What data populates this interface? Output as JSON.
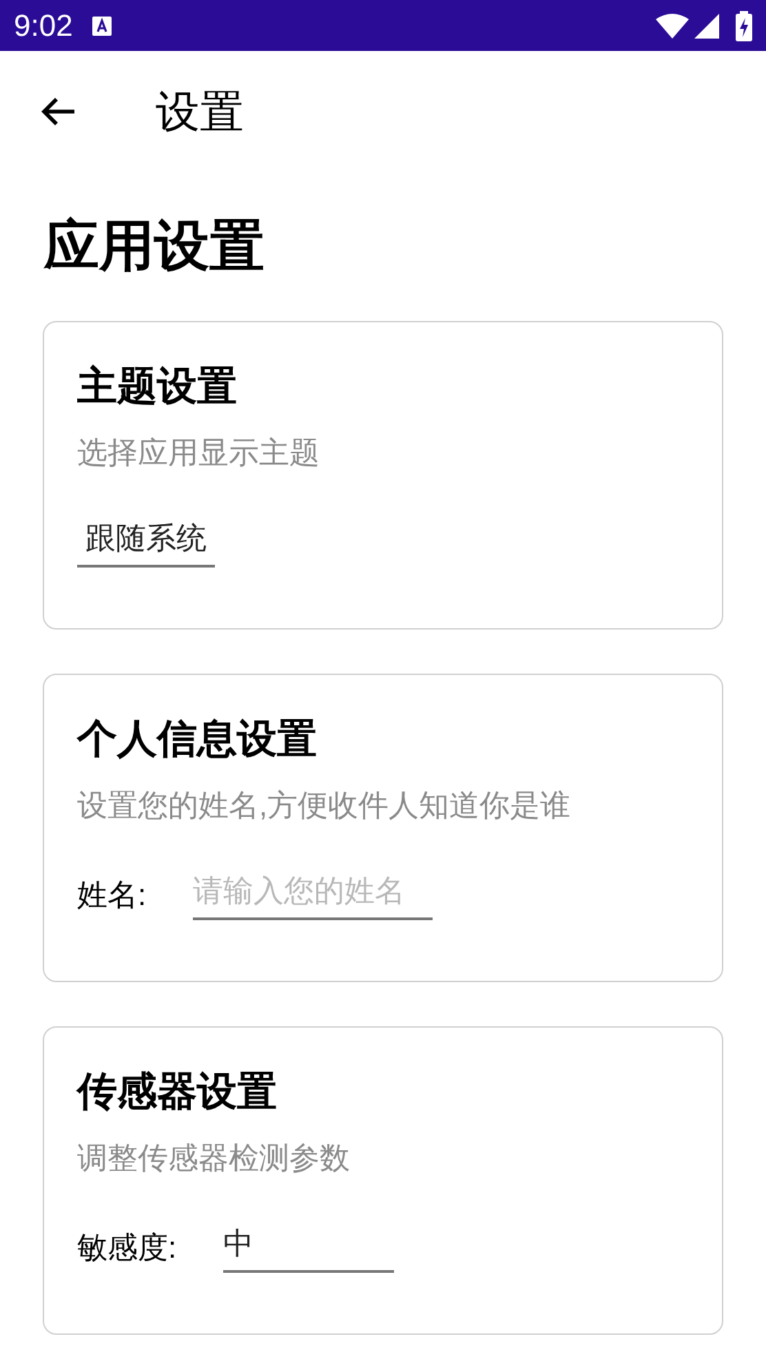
{
  "status_bar": {
    "time": "9:02"
  },
  "toolbar": {
    "title": "设置"
  },
  "heading": "应用设置",
  "cards": [
    {
      "kind": "select",
      "title": "主题设置",
      "subtitle": "选择应用显示主题",
      "value": "跟随系统"
    },
    {
      "kind": "input",
      "title": "个人信息设置",
      "subtitle": "设置您的姓名,方便收件人知道你是谁",
      "label": "姓名:",
      "placeholder": "请输入您的姓名"
    },
    {
      "kind": "select",
      "title": "传感器设置",
      "subtitle": "调整传感器检测参数",
      "label": "敏感度:",
      "value": "中"
    }
  ]
}
